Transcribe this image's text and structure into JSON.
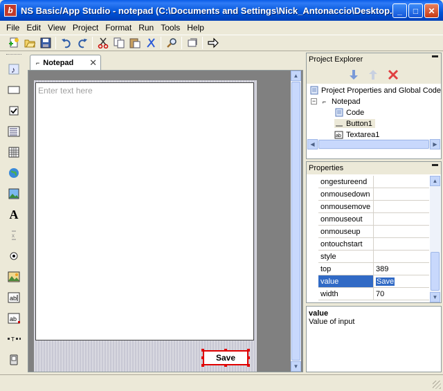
{
  "window": {
    "app_icon_letter": "b",
    "title": "NS Basic/App Studio - notepad (C:\\Documents and Settings\\Nick_Antonaccio\\Desktop...",
    "min": "_",
    "max": "□",
    "close": "✕"
  },
  "menu": [
    "File",
    "Edit",
    "View",
    "Project",
    "Format",
    "Run",
    "Tools",
    "Help"
  ],
  "toolbar_icons": [
    "new-project-icon",
    "open-icon",
    "save-icon",
    "undo-icon",
    "redo-icon",
    "cut-icon",
    "copy-icon",
    "paste-icon",
    "delete-icon",
    "find-icon",
    "deploy-icon",
    "run-icon"
  ],
  "palette_icons": [
    "audio-icon",
    "button-icon",
    "checkbox-icon",
    "list-icon",
    "grid-icon",
    "globe-icon",
    "image-icon",
    "label-icon",
    "spinner-icon",
    "radio-icon",
    "picture-icon",
    "textbox-icon",
    "textarea-icon",
    "html-icon",
    "phone-icon"
  ],
  "editor": {
    "tab_label": "Notepad",
    "tab_close": "✕",
    "textarea_placeholder": "Enter text here",
    "save_button_label": "Save"
  },
  "project_explorer": {
    "title": "Project Explorer",
    "tree": {
      "root": "Project Properties and Global Code",
      "form": "Notepad",
      "children": [
        "Code",
        "Button1",
        "Textarea1"
      ]
    }
  },
  "properties": {
    "title": "Properties",
    "rows": [
      {
        "name": "ongestureend",
        "value": ""
      },
      {
        "name": "onmousedown",
        "value": ""
      },
      {
        "name": "onmousemove",
        "value": ""
      },
      {
        "name": "onmouseout",
        "value": ""
      },
      {
        "name": "onmouseup",
        "value": ""
      },
      {
        "name": "ontouchstart",
        "value": ""
      },
      {
        "name": "style",
        "value": ""
      },
      {
        "name": "top",
        "value": "389"
      },
      {
        "name": "value",
        "value": "Save",
        "selected": true
      },
      {
        "name": "width",
        "value": "70"
      }
    ]
  },
  "description": {
    "title": "value",
    "text": "Value of input"
  },
  "colors": {
    "title_bar": "#0052d6",
    "selection": "#316ac5",
    "selected_control_border": "#e00000"
  }
}
